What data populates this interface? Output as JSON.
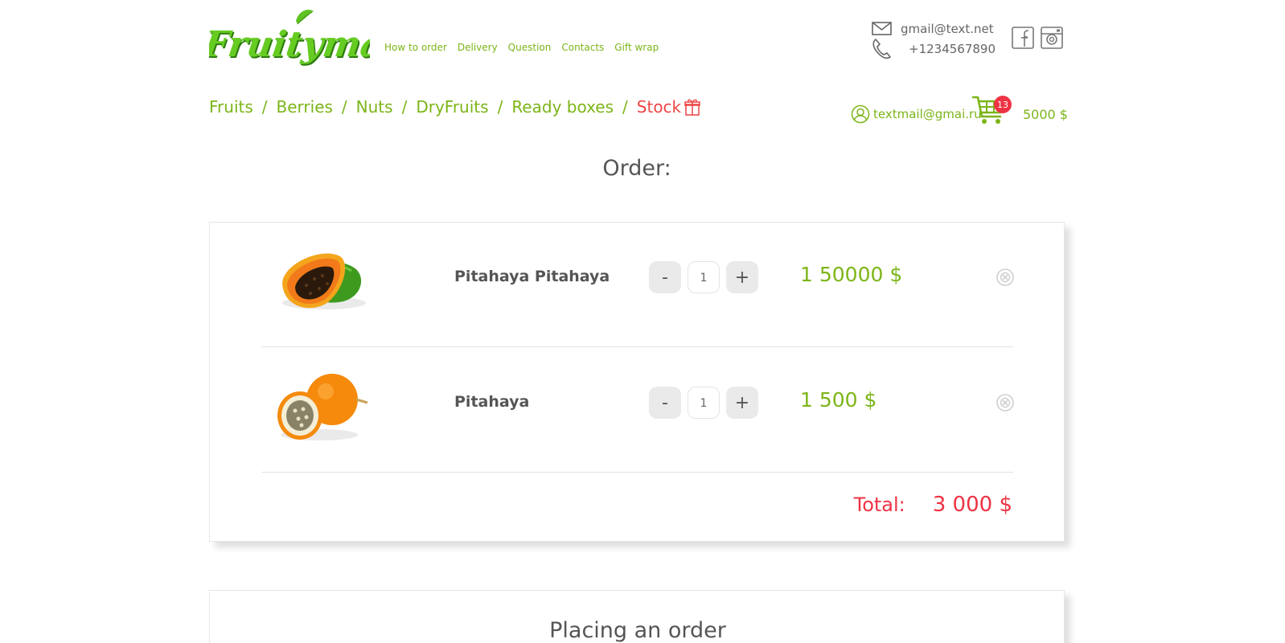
{
  "brand": {
    "name": "Fruitymall",
    "color": "#4cb81c"
  },
  "top_nav": [
    "How to order",
    "Delivery",
    "Question",
    "Contacts",
    "Gift wrap"
  ],
  "contacts": {
    "email": "gmail@text.net",
    "phone": "+1234567890"
  },
  "socials": [
    "facebook-icon",
    "instagram-icon"
  ],
  "categories": [
    "Fruits",
    "Berries",
    "Nuts",
    "DryFruits",
    "Ready boxes",
    "Stock"
  ],
  "category_separator": "/",
  "account": {
    "email": "textmail@gmai.ru"
  },
  "cart": {
    "count": "13",
    "sum": "5000 $"
  },
  "order": {
    "title": "Order:",
    "items": [
      {
        "name": "Pitahaya Pitahaya",
        "qty": "1",
        "price": "1 50000 $",
        "image": "papaya-image"
      },
      {
        "name": "Pitahaya",
        "qty": "1",
        "price": "1 500 $",
        "image": "granadilla-image"
      }
    ],
    "minus_label": "-",
    "plus_label": "+",
    "total_label": "Total:",
    "total_amount": "3 000 $"
  },
  "placing": {
    "title": "Placing an order"
  },
  "colors": {
    "accent": "#7cb518",
    "alert": "#ee3344",
    "text": "#555555"
  }
}
